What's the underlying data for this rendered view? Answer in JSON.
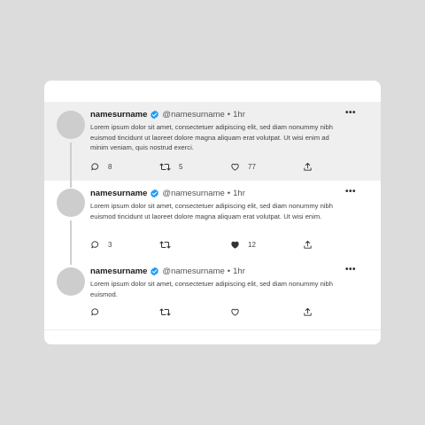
{
  "tweets": [
    {
      "name": "namesurname",
      "handle": "@namesurname",
      "separator": "•",
      "time": "1hr",
      "more": "•••",
      "text": "Lorem ipsum dolor sit amet, consectetuer adipiscing elit, sed diam nonummy nibh euismod tincidunt ut laoreet dolore magna aliquam erat volutpat. Ut wisi enim ad minim veniam, quis nostrud exerci.",
      "replies": "8",
      "retweets": "5",
      "likes": "77",
      "liked": false
    },
    {
      "name": "namesurname",
      "handle": "@namesurname",
      "separator": "•",
      "time": "1hr",
      "more": "•••",
      "text": "Lorem ipsum dolor sit amet, consectetuer adipiscing elit, sed diam nonummy nibh euismod tincidunt ut laoreet dolore magna aliquam erat volutpat. Ut wisi enim.",
      "replies": "3",
      "retweets": "",
      "likes": "12",
      "liked": true
    },
    {
      "name": "namesurname",
      "handle": "@namesurname",
      "separator": "•",
      "time": "1hr",
      "more": "•••",
      "text": "Lorem ipsum dolor sit amet, consectetuer adipiscing elit, sed diam nonummy nibh euismod.",
      "replies": "",
      "retweets": "",
      "likes": "",
      "liked": false
    }
  ],
  "colors": {
    "verified": "#1d9bf0",
    "highlight_bg": "#efefef",
    "avatar": "#cdcdcd",
    "page_bg": "#dcdcdc"
  },
  "icons": [
    "reply-icon",
    "retweet-icon",
    "like-icon",
    "share-icon",
    "verified-badge-icon",
    "more-icon"
  ]
}
